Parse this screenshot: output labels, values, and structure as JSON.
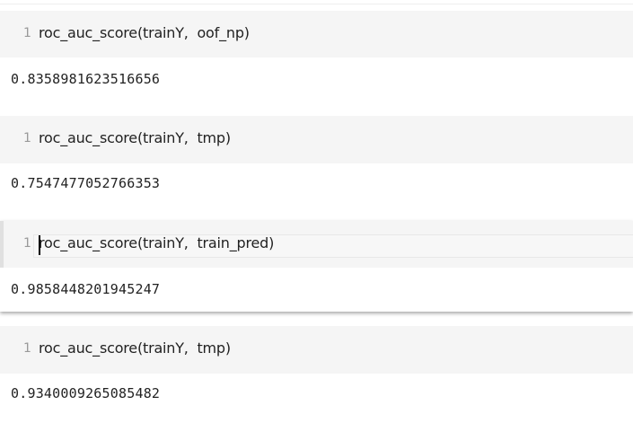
{
  "cells": [
    {
      "line_number": "1",
      "code": "roc_auc_score(trainY,  oof_np)",
      "output": "0.8358981623516656"
    },
    {
      "line_number": "1",
      "code": "roc_auc_score(trainY,  tmp)",
      "output": "0.7547477052766353"
    },
    {
      "line_number": "1",
      "code": "roc_auc_score(trainY,  train_pred)",
      "output": "0.9858448201945247"
    },
    {
      "line_number": "1",
      "code": "roc_auc_score(trainY,  tmp)",
      "output": "0.9340009265085482"
    }
  ]
}
